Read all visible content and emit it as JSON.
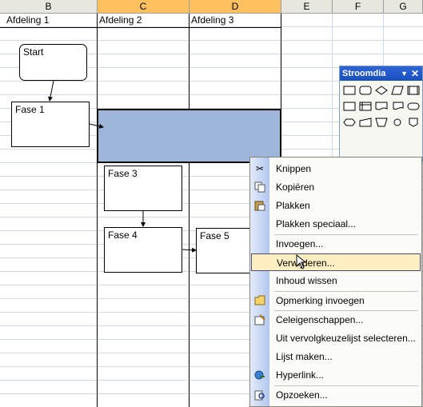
{
  "columns": [
    {
      "letter": "B",
      "selected": false
    },
    {
      "letter": "C",
      "selected": true
    },
    {
      "letter": "D",
      "selected": true
    },
    {
      "letter": "E",
      "selected": false
    },
    {
      "letter": "F",
      "selected": false
    },
    {
      "letter": "G",
      "selected": false
    }
  ],
  "cells": {
    "b1": "Afdeling 1",
    "c1": "Afdeling 2",
    "d1": "Afdeling 3"
  },
  "shapes": {
    "start": "Start",
    "fase1": "Fase 1",
    "fase3": "Fase 3",
    "fase4": "Fase 4",
    "fase5": "Fase 5"
  },
  "toolbar": {
    "title": "Stroomdia",
    "dropdown_icon": "triangle-down-icon",
    "close_icon": "close-icon"
  },
  "menu": {
    "items": [
      {
        "label": "Knippen",
        "icon": "scissors-icon"
      },
      {
        "label": "Kopiëren",
        "icon": "copy-icon"
      },
      {
        "label": "Plakken",
        "icon": "paste-icon"
      },
      {
        "label": "Plakken speciaal...",
        "icon": ""
      },
      {
        "label": "Invoegen...",
        "icon": ""
      },
      {
        "label": "Verwijderen...",
        "icon": "",
        "highlighted": true
      },
      {
        "label": "Inhoud wissen",
        "icon": ""
      },
      {
        "label": "Opmerking invoegen",
        "icon": "comment-icon"
      },
      {
        "label": "Celeigenschappen...",
        "icon": "format-cells-icon"
      },
      {
        "label": "Uit vervolgkeuzelijst selecteren...",
        "icon": ""
      },
      {
        "label": "Lijst maken...",
        "icon": ""
      },
      {
        "label": "Hyperlink...",
        "icon": "hyperlink-icon"
      },
      {
        "label": "Opzoeken...",
        "icon": "research-icon"
      }
    ]
  },
  "colors": {
    "selection": "#9fb6db",
    "header_selected": "#ffc060",
    "menu_highlight": "#ffeec2"
  }
}
